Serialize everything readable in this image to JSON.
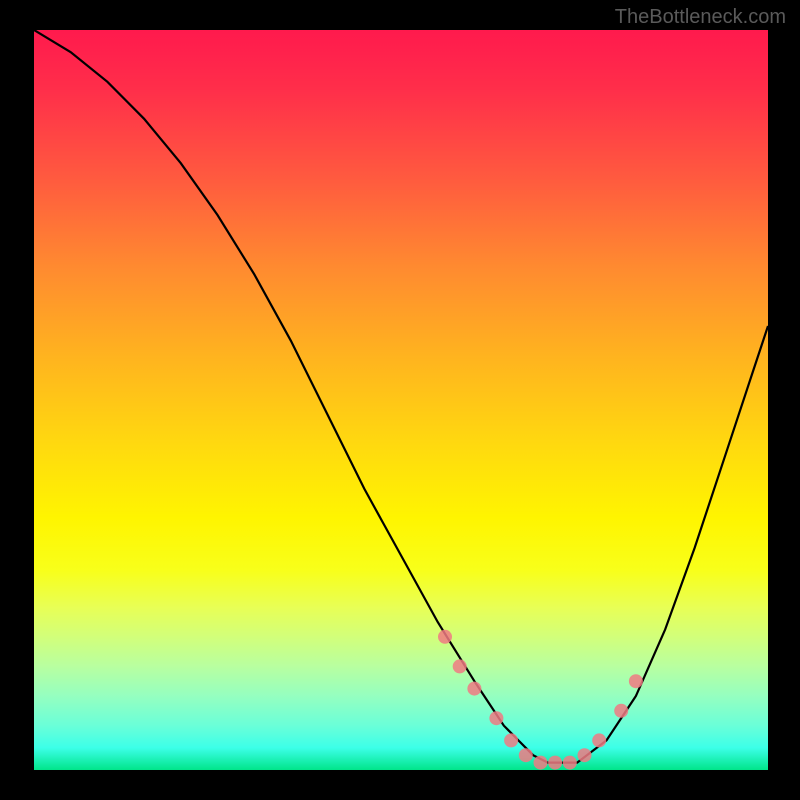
{
  "watermark": "TheBottleneck.com",
  "chart_data": {
    "type": "line",
    "title": "",
    "xlabel": "",
    "ylabel": "",
    "xlim": [
      0,
      100
    ],
    "ylim": [
      0,
      100
    ],
    "curve": {
      "name": "bottleneck-curve",
      "x": [
        0,
        5,
        10,
        15,
        20,
        25,
        30,
        35,
        40,
        45,
        50,
        55,
        60,
        62,
        64,
        66,
        68,
        70,
        72,
        74,
        78,
        82,
        86,
        90,
        94,
        98,
        100
      ],
      "y": [
        100,
        97,
        93,
        88,
        82,
        75,
        67,
        58,
        48,
        38,
        29,
        20,
        12,
        9,
        6,
        4,
        2,
        1,
        1,
        1,
        4,
        10,
        19,
        30,
        42,
        54,
        60
      ]
    },
    "markers": {
      "name": "highlight-points",
      "color": "#f07a82",
      "x": [
        56,
        58,
        60,
        63,
        65,
        67,
        69,
        71,
        73,
        75,
        77,
        80,
        82
      ],
      "y": [
        18,
        14,
        11,
        7,
        4,
        2,
        1,
        1,
        1,
        2,
        4,
        8,
        12
      ]
    },
    "gradient_stops": [
      {
        "pos": 0.0,
        "color": "#ff1a4d"
      },
      {
        "pos": 0.5,
        "color": "#ffd500"
      },
      {
        "pos": 0.8,
        "color": "#eaff60"
      },
      {
        "pos": 1.0,
        "color": "#00e58a"
      }
    ]
  }
}
